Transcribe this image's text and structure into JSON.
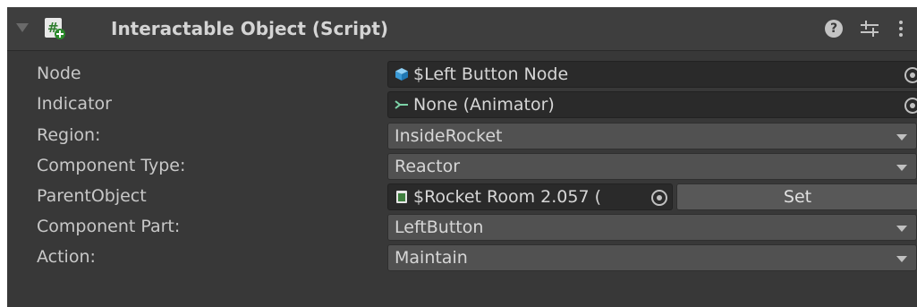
{
  "component": {
    "title": "Interactable Object (Script)",
    "help_glyph": "?",
    "icons": [
      "foldout-triangle-icon",
      "script-icon",
      "help-icon",
      "preset-icon",
      "kebab-menu-icon"
    ]
  },
  "fields": {
    "node": {
      "label": "Node",
      "value": "$Left Button Node",
      "icon": "gameobject-cube-icon",
      "icon_color": "#4fb0e8"
    },
    "indicator": {
      "label": "Indicator",
      "value": "None (Animator)",
      "icon": "animator-icon",
      "icon_color": "#7dd3a8"
    },
    "region": {
      "label": "Region:",
      "value": "InsideRocket"
    },
    "component_type": {
      "label": "Component Type:",
      "value": "Reactor"
    },
    "parent_object": {
      "label": "ParentObject",
      "value": "$Rocket Room 2.057 (",
      "icon": "prefab-asset-icon",
      "button_label": "Set"
    },
    "component_part": {
      "label": "Component Part:",
      "value": "LeftButton"
    },
    "action": {
      "label": "Action:",
      "value": "Maintain"
    }
  },
  "colors": {
    "panel": "#383838",
    "header": "#3e3e3e",
    "object_field": "#2a2a2a",
    "dropdown": "#515151",
    "text": "#c8c8c8"
  }
}
